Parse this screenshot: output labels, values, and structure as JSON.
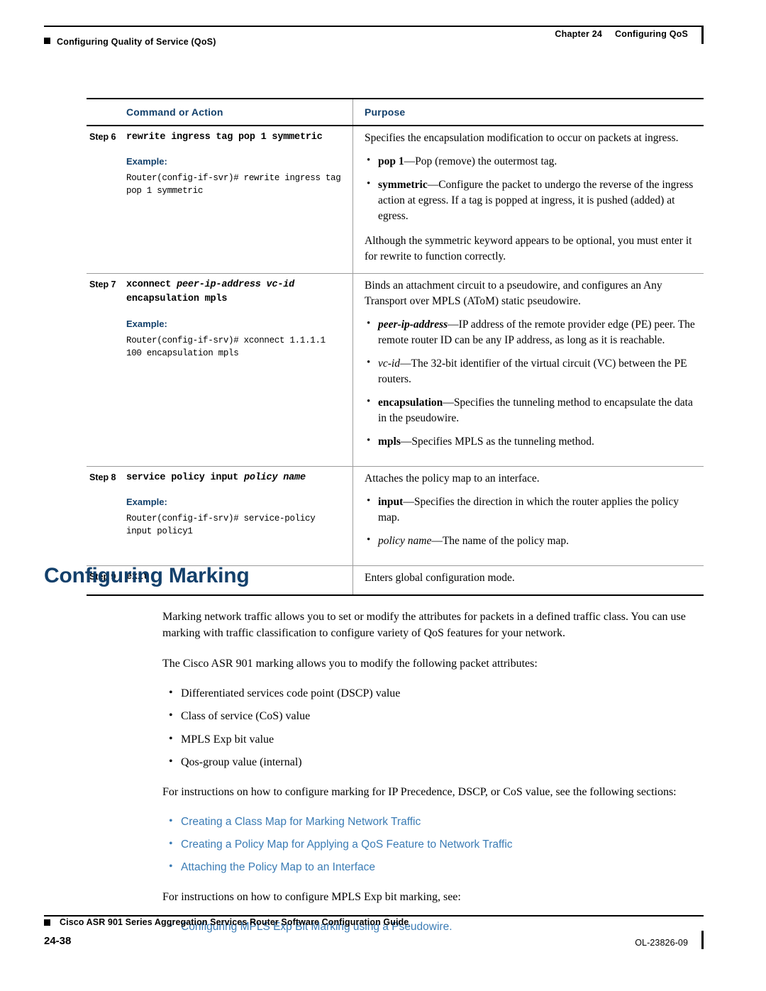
{
  "header": {
    "left_text": "Configuring Quality of Service (QoS)",
    "chapter_label": "Chapter 24",
    "chapter_title": "Configuring QoS"
  },
  "table": {
    "headers": {
      "command": "Command or Action",
      "purpose": "Purpose"
    },
    "rows": [
      {
        "step": "Step 6",
        "command_bold": "rewrite ingress tag pop 1 symmetric",
        "example_label": "Example:",
        "example_text": "Router(config-if-svr)# rewrite ingress tag pop 1 symmetric",
        "purpose_intro": "Specifies the encapsulation modification to occur on packets at ingress.",
        "bullets": [
          "pop 1—Pop (remove) the outermost tag.",
          "symmetric—Configure the packet to undergo the reverse of the ingress action at egress. If a tag is popped at ingress, it is pushed (added) at egress."
        ],
        "purpose_trailer": "Although the symmetric keyword appears to be optional, you must enter it for rewrite to function correctly."
      },
      {
        "step": "Step 7",
        "command_bold": "xconnect peer-ip-address vc-id",
        "command_bold2": "encapsulation mpls",
        "example_label": "Example:",
        "example_text": "Router(config-if-srv)# xconnect 1.1.1.1 100 encapsulation mpls",
        "purpose_intro": "Binds an attachment circuit to a pseudowire, and configures an Any Transport over MPLS (AToM) static pseudowire.",
        "bullets": [
          "peer-ip-address—IP address of the remote provider edge (PE) peer. The remote router ID can be any IP address, as long as it is reachable.",
          "vc-id—The 32-bit identifier of the virtual circuit (VC) between the PE routers.",
          "encapsulation—Specifies the tunneling method to encapsulate the data in the pseudowire.",
          "mpls—Specifies MPLS as the tunneling method."
        ]
      },
      {
        "step": "Step 8",
        "command_bold": "service policy input policy name",
        "example_label": "Example:",
        "example_text": "Router(config-if-srv)# service-policy input policy1",
        "purpose_intro": "Attaches the policy map to an interface.",
        "bullets": [
          "input—Specifies the direction in which the router applies the policy map.",
          "policy name—The name of the policy map."
        ]
      },
      {
        "step": "Step 9",
        "command_bold": "exit",
        "purpose_intro": "Enters global configuration mode."
      }
    ]
  },
  "section": {
    "title": "Configuring Marking",
    "paragraphs": [
      "Marking network traffic allows you to set or modify the attributes for packets in a defined traffic class. You can use marking with traffic classification to configure variety of QoS features for your network.",
      "The Cisco ASR 901 marking allows you to modify the following packet attributes:"
    ],
    "attribute_list": [
      "Differentiated services code point (DSCP) value",
      "Class of service (CoS) value",
      "MPLS Exp bit value",
      "Qos-group value (internal)"
    ],
    "instructions_intro": "For instructions on how to configure marking for IP Precedence, DSCP, or CoS value, see the following sections:",
    "links": [
      "Creating a Class Map for Marking Network Traffic",
      "Creating a Policy Map for Applying a QoS Feature to Network Traffic",
      "Attaching the Policy Map to an Interface"
    ],
    "mpls_intro": "For instructions on how to configure MPLS Exp bit marking, see:",
    "mpls_links": [
      "Configuring MPLS Exp Bit Marking using a Pseudowire."
    ]
  },
  "footer": {
    "guide_title": "Cisco ASR 901 Series Aggregation Services Router Software Configuration Guide",
    "page_number": "24-38",
    "doc_id": "OL-23826-09"
  }
}
